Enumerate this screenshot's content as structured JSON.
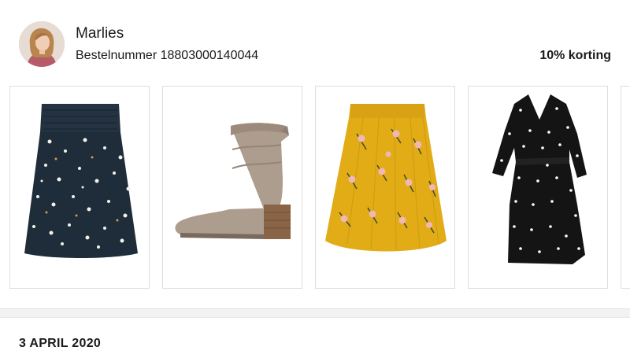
{
  "customer": {
    "name": "Marlies",
    "order_label": "Bestelnummer 18803000140044",
    "discount": "10% korting"
  },
  "products": [
    {
      "icon": "navy-floral-skirt"
    },
    {
      "icon": "taupe-suede-ankle-boot"
    },
    {
      "icon": "yellow-floral-skirt"
    },
    {
      "icon": "black-polka-dot-wrap-dress"
    }
  ],
  "section": {
    "date": "3 APRIL 2020"
  }
}
